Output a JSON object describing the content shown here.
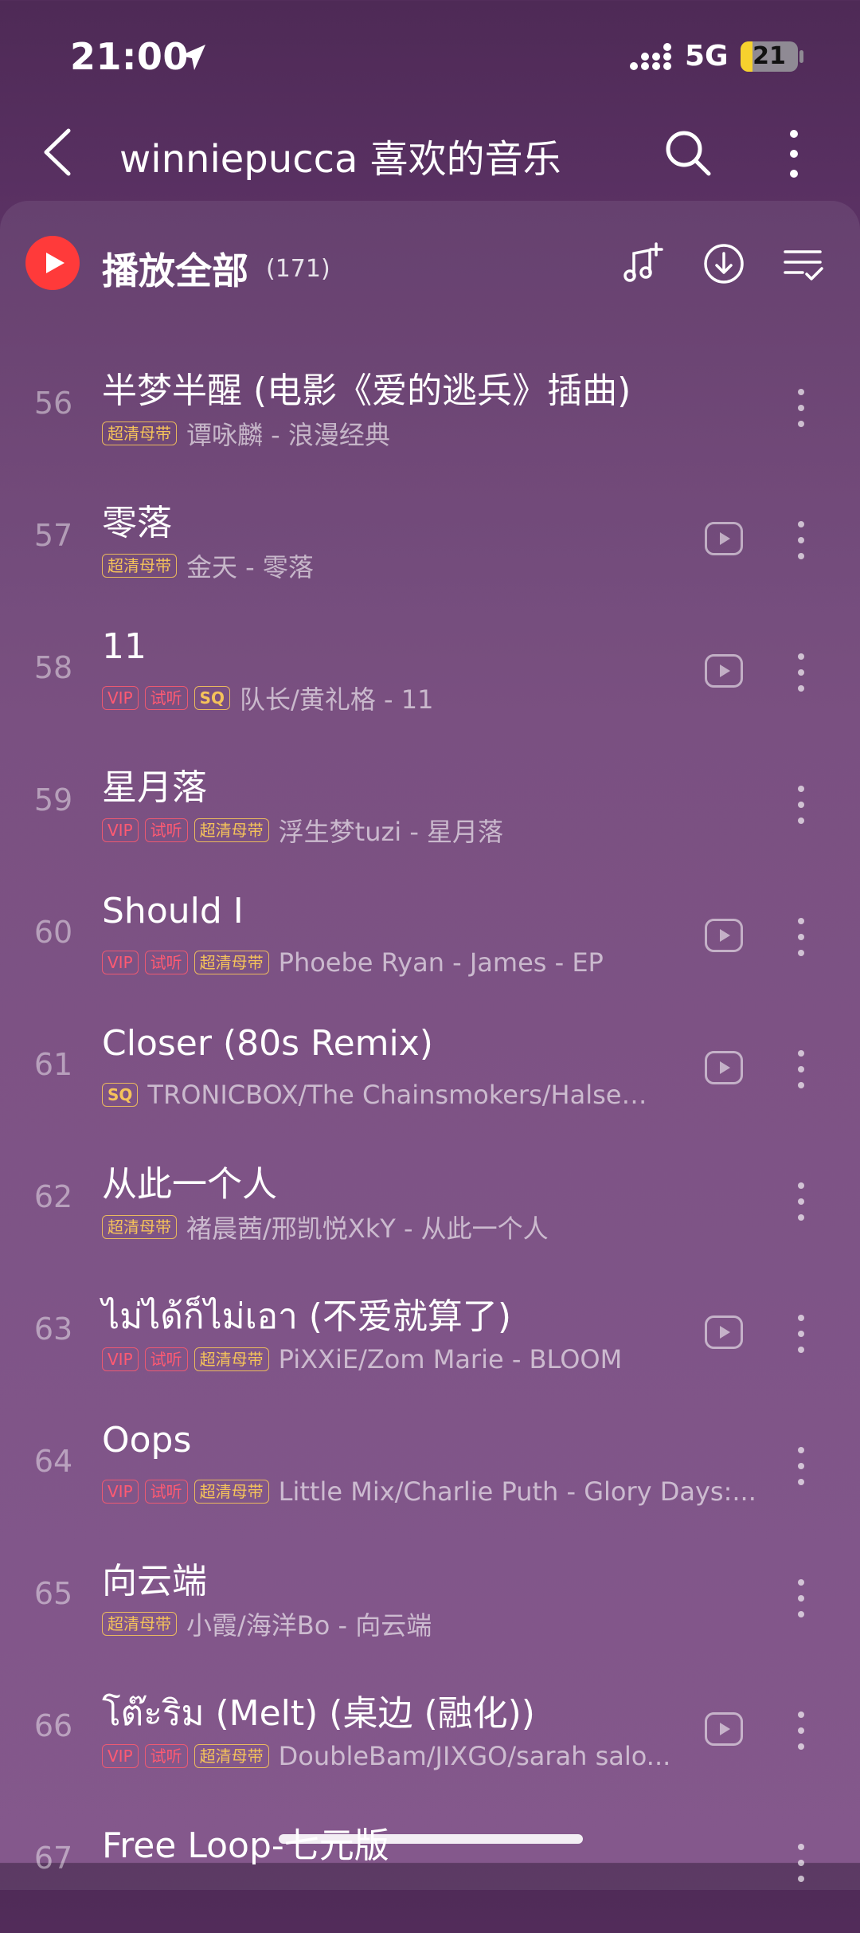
{
  "status_bar": {
    "time": "21:00",
    "network": "5G",
    "battery": "21"
  },
  "header": {
    "title": "winniepucca 喜欢的音乐"
  },
  "playlist": {
    "play_all_label": "播放全部",
    "count": "(171)"
  },
  "songs": [
    {
      "num": "56",
      "title": "半梦半醒 (电影《爱的逃兵》插曲)",
      "tags": [
        "超清母带"
      ],
      "artist": "谭咏麟 - 浪漫经典",
      "mv": false
    },
    {
      "num": "57",
      "title": "零落",
      "tags": [
        "超清母带"
      ],
      "artist": "金天 - 零落",
      "mv": true
    },
    {
      "num": "58",
      "title": "11",
      "tags": [
        "VIP",
        "试听",
        "SQ"
      ],
      "artist": "队长/黄礼格 - 11",
      "mv": true
    },
    {
      "num": "59",
      "title": "星月落",
      "tags": [
        "VIP",
        "试听",
        "超清母带"
      ],
      "artist": "浮生梦tuzi - 星月落",
      "mv": false
    },
    {
      "num": "60",
      "title": "Should I",
      "tags": [
        "VIP",
        "试听",
        "超清母带"
      ],
      "artist": "Phoebe Ryan - James - EP",
      "mv": true
    },
    {
      "num": "61",
      "title": "Closer (80s Remix)",
      "tags": [
        "SQ"
      ],
      "artist": "TRONICBOX/The Chainsmokers/Halsey -...",
      "mv": true
    },
    {
      "num": "62",
      "title": "从此一个人",
      "tags": [
        "超清母带"
      ],
      "artist": "褚晨茜/邢凯悦XkY - 从此一个人",
      "mv": false
    },
    {
      "num": "63",
      "title": "ไม่ได้ก็ไม่เอา (不爱就算了)",
      "tags": [
        "VIP",
        "试听",
        "超清母带"
      ],
      "artist": "PiXXiE/Zom Marie - BLOOM",
      "mv": true
    },
    {
      "num": "64",
      "title": "Oops",
      "tags": [
        "VIP",
        "试听",
        "超清母带"
      ],
      "artist": "Little Mix/Charlie Puth - Glory Days:...",
      "mv": false
    },
    {
      "num": "65",
      "title": "向云端",
      "tags": [
        "超清母带"
      ],
      "artist": "小霞/海洋Bo - 向云端",
      "mv": false
    },
    {
      "num": "66",
      "title": "โต๊ะริม (Melt) (桌边 (融化))",
      "tags": [
        "VIP",
        "试听",
        "超清母带"
      ],
      "artist": "DoubleBam/JIXGO/sarah salo...",
      "mv": true
    },
    {
      "num": "67",
      "title": "Free Loop-七元版",
      "tags": [],
      "artist": "",
      "mv": false
    }
  ]
}
